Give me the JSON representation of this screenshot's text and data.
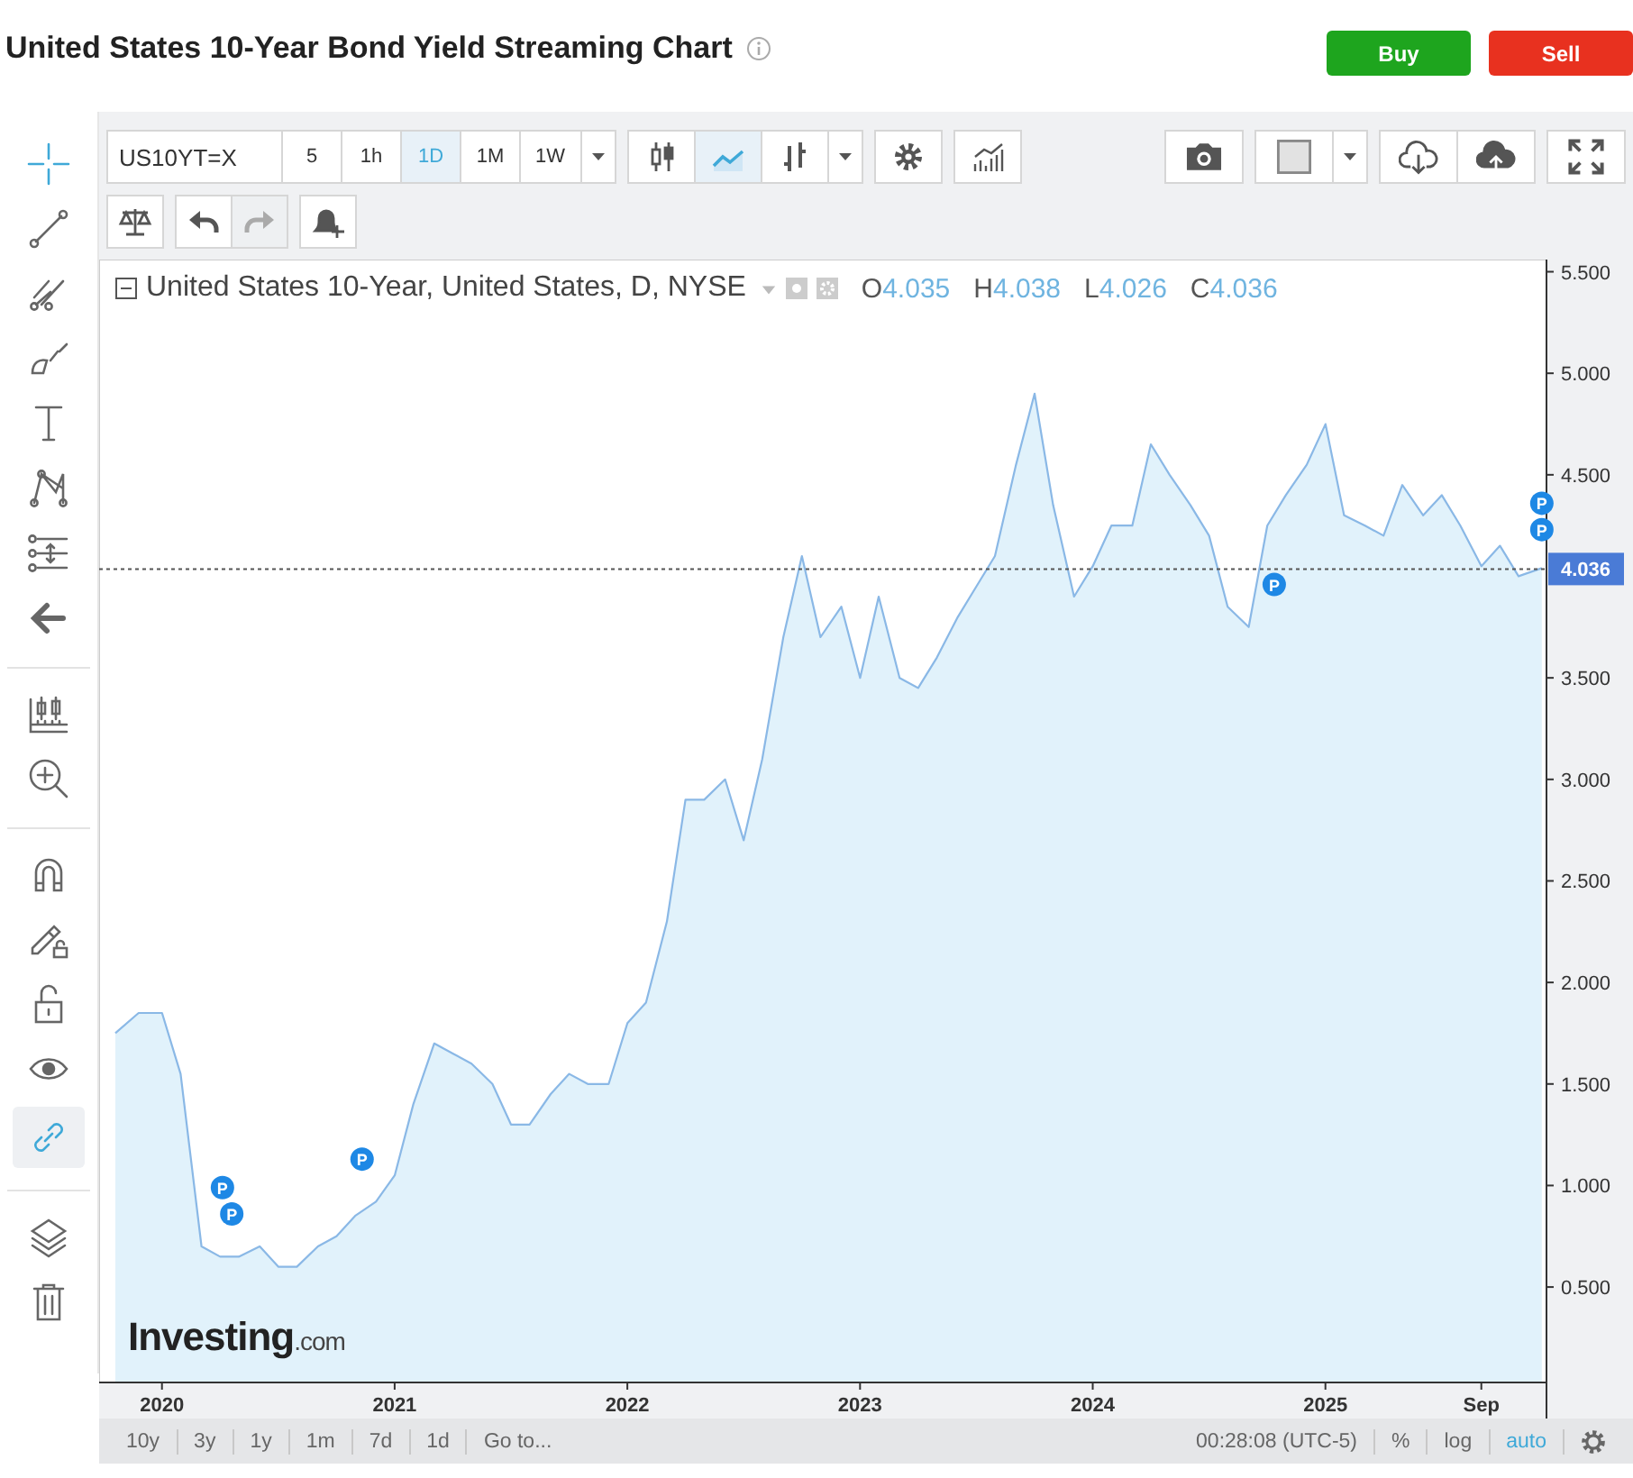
{
  "header": {
    "title": "United States 10-Year Bond Yield Streaming Chart",
    "buttons": [
      {
        "kind": "buy",
        "label": "Buy"
      },
      {
        "kind": "sell",
        "label": "Sell"
      }
    ]
  },
  "sidebar": {
    "groups": [
      {
        "tools": [
          {
            "kind": "crosshair",
            "selected": true
          },
          {
            "kind": "trend-line",
            "selected": false
          },
          {
            "kind": "pitchfork",
            "selected": false
          },
          {
            "kind": "brush",
            "selected": false
          },
          {
            "kind": "text",
            "selected": false
          },
          {
            "kind": "pattern",
            "selected": false
          },
          {
            "kind": "measure",
            "selected": false
          },
          {
            "kind": "back",
            "selected": false
          }
        ]
      },
      {
        "tools": [
          {
            "kind": "ruler",
            "selected": false
          },
          {
            "kind": "zoom",
            "selected": false
          }
        ]
      },
      {
        "tools": [
          {
            "kind": "magnet",
            "selected": false
          },
          {
            "kind": "pencil-lock",
            "selected": false
          },
          {
            "kind": "lock",
            "selected": false
          },
          {
            "kind": "eye",
            "selected": false
          },
          {
            "kind": "link",
            "selected": true
          }
        ]
      },
      {
        "tools": [
          {
            "kind": "layers",
            "selected": false
          },
          {
            "kind": "trash",
            "selected": false
          }
        ]
      }
    ]
  },
  "toolbar": {
    "left_groups": [
      {
        "items": [
          {
            "kind": "symbol",
            "label": "US10YT=X"
          },
          {
            "kind": "interval",
            "label": "5",
            "selected": false
          },
          {
            "kind": "interval",
            "label": "1h",
            "selected": false
          },
          {
            "kind": "interval",
            "label": "1D",
            "selected": true
          },
          {
            "kind": "interval",
            "label": "1M",
            "selected": false
          },
          {
            "kind": "interval",
            "label": "1W",
            "selected": false
          },
          {
            "kind": "caret"
          }
        ]
      },
      {
        "items": [
          {
            "kind": "candles",
            "selected": false
          },
          {
            "kind": "line",
            "selected": true
          },
          {
            "kind": "bars",
            "selected": false
          },
          {
            "kind": "caret"
          }
        ]
      },
      {
        "items": [
          {
            "kind": "gear"
          }
        ]
      },
      {
        "items": [
          {
            "kind": "indicators"
          }
        ]
      }
    ],
    "right_groups": [
      {
        "items": [
          {
            "kind": "camera"
          }
        ]
      },
      {
        "items": [
          {
            "kind": "color"
          },
          {
            "kind": "caret"
          }
        ]
      },
      {
        "items": [
          {
            "kind": "cloud-down"
          },
          {
            "kind": "cloud-up"
          }
        ]
      },
      {
        "items": [
          {
            "kind": "fullscreen"
          }
        ]
      }
    ],
    "second_row": [
      {
        "items": [
          {
            "kind": "scales"
          }
        ]
      },
      {
        "items": [
          {
            "kind": "undo",
            "disabled": false
          },
          {
            "kind": "redo",
            "disabled": true
          }
        ]
      },
      {
        "items": [
          {
            "kind": "alert"
          }
        ]
      }
    ]
  },
  "legend": {
    "title": "United States 10-Year, United States, D, NYSE",
    "values": [
      {
        "key": "O",
        "value": "4.035"
      },
      {
        "key": "H",
        "value": "4.038"
      },
      {
        "key": "L",
        "value": "4.026"
      },
      {
        "key": "C",
        "value": "4.036"
      }
    ]
  },
  "logo": {
    "name": "Investing",
    "suffix": ".com"
  },
  "chart_data": {
    "type": "area",
    "xlim": [
      2019.73,
      2025.95
    ],
    "ylim": [
      0.03,
      5.56
    ],
    "x": [
      2019.8,
      2019.9,
      2020.0,
      2020.08,
      2020.17,
      2020.25,
      2020.33,
      2020.42,
      2020.5,
      2020.58,
      2020.67,
      2020.75,
      2020.83,
      2020.92,
      2021.0,
      2021.08,
      2021.17,
      2021.25,
      2021.33,
      2021.42,
      2021.5,
      2021.58,
      2021.67,
      2021.75,
      2021.83,
      2021.92,
      2022.0,
      2022.08,
      2022.17,
      2022.25,
      2022.33,
      2022.42,
      2022.5,
      2022.58,
      2022.67,
      2022.75,
      2022.83,
      2022.92,
      2023.0,
      2023.08,
      2023.17,
      2023.25,
      2023.33,
      2023.42,
      2023.5,
      2023.58,
      2023.67,
      2023.75,
      2023.83,
      2023.92,
      2024.0,
      2024.08,
      2024.17,
      2024.25,
      2024.33,
      2024.42,
      2024.5,
      2024.58,
      2024.67,
      2024.75,
      2024.83,
      2024.92,
      2025.0,
      2025.08,
      2025.17,
      2025.25,
      2025.33,
      2025.42,
      2025.5,
      2025.58,
      2025.67,
      2025.75,
      2025.83,
      2025.93
    ],
    "series": [
      {
        "color": "#8ab8e6",
        "values": [
          1.75,
          1.85,
          1.85,
          1.55,
          0.7,
          0.65,
          0.65,
          0.7,
          0.6,
          0.6,
          0.7,
          0.75,
          0.85,
          0.92,
          1.05,
          1.4,
          1.7,
          1.65,
          1.6,
          1.5,
          1.3,
          1.3,
          1.45,
          1.55,
          1.5,
          1.5,
          1.8,
          1.9,
          2.3,
          2.9,
          2.9,
          3.0,
          2.7,
          3.1,
          3.7,
          4.1,
          3.7,
          3.85,
          3.5,
          3.9,
          3.5,
          3.45,
          3.6,
          3.8,
          3.95,
          4.1,
          4.55,
          4.9,
          4.35,
          3.9,
          4.05,
          4.25,
          4.25,
          4.65,
          4.5,
          4.35,
          4.2,
          3.85,
          3.75,
          4.25,
          4.4,
          4.55,
          4.75,
          4.3,
          4.25,
          4.2,
          4.45,
          4.3,
          4.4,
          4.25,
          4.05,
          4.15,
          4.0,
          4.04
        ]
      }
    ],
    "xticks": [
      {
        "value": 2020,
        "label": "2020"
      },
      {
        "value": 2021,
        "label": "2021"
      },
      {
        "value": 2022,
        "label": "2022"
      },
      {
        "value": 2023,
        "label": "2023"
      },
      {
        "value": 2024,
        "label": "2024"
      },
      {
        "value": 2025,
        "label": "2025"
      },
      {
        "value": 2025.67,
        "label": "Sep"
      }
    ],
    "yticks": [
      {
        "value": 0.5,
        "label": "0.500"
      },
      {
        "value": 1.0,
        "label": "1.000"
      },
      {
        "value": 1.5,
        "label": "1.500"
      },
      {
        "value": 2.0,
        "label": "2.000"
      },
      {
        "value": 2.5,
        "label": "2.500"
      },
      {
        "value": 3.0,
        "label": "3.000"
      },
      {
        "value": 3.5,
        "label": "3.500"
      },
      {
        "value": 4.5,
        "label": "4.500"
      },
      {
        "value": 5.0,
        "label": "5.000"
      },
      {
        "value": 5.5,
        "label": "5.500"
      }
    ],
    "ref_lines": [
      {
        "axis": "y",
        "value": 4.036,
        "label": "4.036"
      }
    ],
    "annotations": [
      {
        "x": 2020.26,
        "y": 0.99,
        "text": "P"
      },
      {
        "x": 2020.3,
        "y": 0.86,
        "text": "P"
      },
      {
        "x": 2020.86,
        "y": 1.13,
        "text": "P"
      },
      {
        "x": 2024.78,
        "y": 3.96,
        "text": "P"
      },
      {
        "x": 2025.93,
        "y": 4.36,
        "text": "P"
      },
      {
        "x": 2025.93,
        "y": 4.23,
        "text": "P"
      }
    ]
  },
  "bottom_bar": {
    "ranges": [
      "10y",
      "3y",
      "1y",
      "1m",
      "7d",
      "1d"
    ],
    "goto": "Go to...",
    "time": "00:28:08 (UTC-5)",
    "scale_options": [
      {
        "label": "%",
        "selected": false
      },
      {
        "label": "log",
        "selected": false
      },
      {
        "label": "auto",
        "selected": true
      }
    ]
  }
}
